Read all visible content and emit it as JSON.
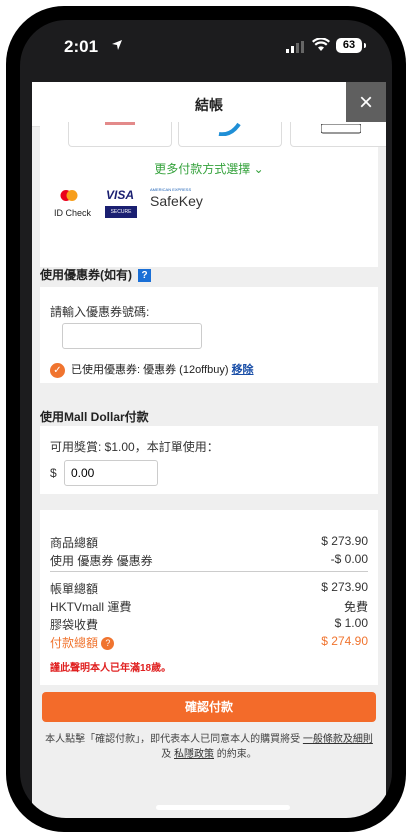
{
  "status": {
    "time": "2:01",
    "battery": "63"
  },
  "sheet": {
    "title": "結帳",
    "close_label": "×"
  },
  "payment": {
    "more_methods": "更多付款方式選擇 ⌄",
    "id_check": "ID Check",
    "visa": "VISA",
    "visa_secure": "SECURE",
    "amex": "AMERICAN EXPRESS",
    "safekey": "SafeKey"
  },
  "coupon": {
    "title": "使用優惠券(如有)",
    "help": "?",
    "input_label": "請輸入優惠券號碼:",
    "input_value": "",
    "applied_text": "已使用優惠券: 優惠券 (12offbuy)",
    "remove_label": "移除"
  },
  "mall_dollar": {
    "title": "使用Mall Dollar付款",
    "available": "可用獎賞: $1.00，本訂單使用：",
    "currency": "$",
    "input_value": "0.00"
  },
  "summary": {
    "rows": [
      {
        "label": "商品總額",
        "value": "$ 273.90"
      },
      {
        "label": "使用 優惠券 優惠券",
        "value": "-$ 0.00"
      },
      {
        "label": "帳單總額",
        "value": "$ 273.90"
      },
      {
        "label": "HKTVmall 運費",
        "value": "免費"
      },
      {
        "label": "膠袋收費",
        "value": "$ 1.00"
      }
    ],
    "total_label": "付款總額",
    "total_value": "$ 274.90",
    "age_note": "謹此聲明本人已年滿18歲。"
  },
  "confirm_label": "確認付款",
  "terms": {
    "prefix": "本人點擊「確認付款」，即代表本人已同意本人的購買將受",
    "link1": "一般條款及細則",
    "and": "及",
    "link2": "私隱政策",
    "suffix": "的約束。"
  },
  "colors": {
    "accent": "#f36b2a",
    "green": "#35a23c",
    "link": "#1a4fa8"
  }
}
